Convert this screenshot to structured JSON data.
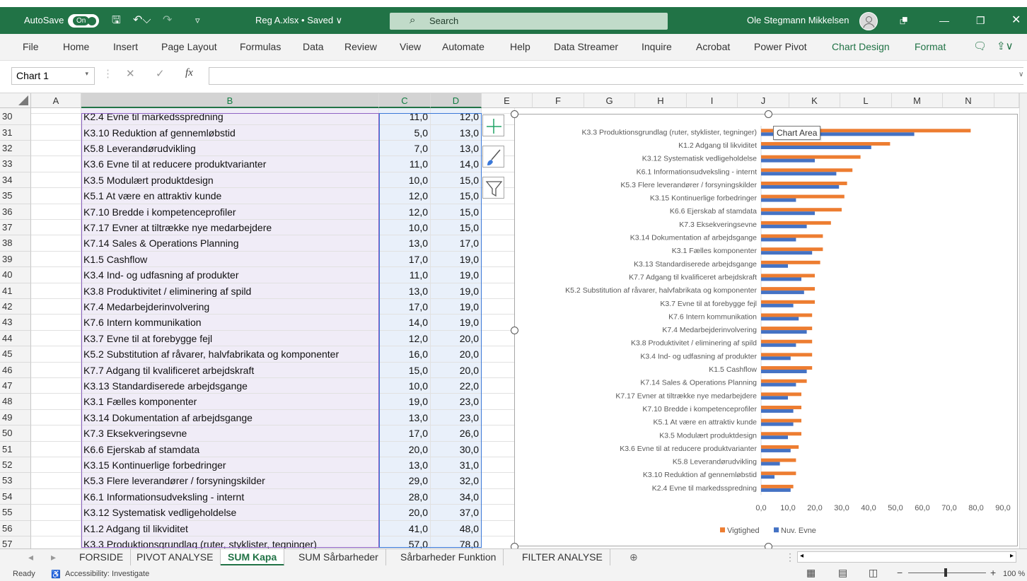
{
  "titlebar": {
    "autosave_label": "AutoSave",
    "autosave_state": "On",
    "doc_title": "Reg A.xlsx • Saved ∨",
    "search_placeholder": "Search",
    "user_name": "Ole Stegmann Mikkelsen"
  },
  "menu": [
    "File",
    "Home",
    "Insert",
    "Page Layout",
    "Formulas",
    "Data",
    "Review",
    "View",
    "Automate",
    "Help",
    "Data Streamer",
    "Inquire",
    "Acrobat",
    "Power Pivot",
    "Chart Design",
    "Format"
  ],
  "formula_bar": {
    "name_box": "Chart 1",
    "fx": "fx",
    "value": ""
  },
  "columns": [
    "A",
    "B",
    "C",
    "D",
    "E",
    "F",
    "G",
    "H",
    "I",
    "J",
    "K",
    "L",
    "M",
    "N"
  ],
  "rows": [
    {
      "n": "30",
      "b": "K2.4 Evne til markedsspredning",
      "c": "11,0",
      "d": "12,0"
    },
    {
      "n": "31",
      "b": "K3.10 Reduktion af gennemløbstid",
      "c": "5,0",
      "d": "13,0"
    },
    {
      "n": "32",
      "b": "K5.8 Leverandørudvikling",
      "c": "7,0",
      "d": "13,0"
    },
    {
      "n": "33",
      "b": "K3.6 Evne til at reducere produktvarianter",
      "c": "11,0",
      "d": "14,0"
    },
    {
      "n": "34",
      "b": "K3.5 Modulært produktdesign",
      "c": "10,0",
      "d": "15,0"
    },
    {
      "n": "35",
      "b": "K5.1 At være en attraktiv kunde",
      "c": "12,0",
      "d": "15,0"
    },
    {
      "n": "36",
      "b": "K7.10 Bredde i kompetenceprofiler",
      "c": "12,0",
      "d": "15,0"
    },
    {
      "n": "37",
      "b": "K7.17 Evner at tiltrække nye medarbejdere",
      "c": "10,0",
      "d": "15,0"
    },
    {
      "n": "38",
      "b": "K7.14 Sales & Operations Planning",
      "c": "13,0",
      "d": "17,0"
    },
    {
      "n": "39",
      "b": "K1.5 Cashflow",
      "c": "17,0",
      "d": "19,0"
    },
    {
      "n": "40",
      "b": "K3.4 Ind- og udfasning af produkter",
      "c": "11,0",
      "d": "19,0"
    },
    {
      "n": "41",
      "b": "K3.8 Produktivitet / eliminering af spild",
      "c": "13,0",
      "d": "19,0"
    },
    {
      "n": "42",
      "b": "K7.4 Medarbejderinvolvering",
      "c": "17,0",
      "d": "19,0"
    },
    {
      "n": "43",
      "b": "K7.6 Intern kommunikation",
      "c": "14,0",
      "d": "19,0"
    },
    {
      "n": "44",
      "b": "K3.7 Evne til at forebygge fejl",
      "c": "12,0",
      "d": "20,0"
    },
    {
      "n": "45",
      "b": "K5.2 Substitution af råvarer, halvfabrikata og komponenter",
      "c": "16,0",
      "d": "20,0"
    },
    {
      "n": "46",
      "b": "K7.7 Adgang til kvalificeret arbejdskraft",
      "c": "15,0",
      "d": "20,0"
    },
    {
      "n": "47",
      "b": "K3.13 Standardiserede arbejdsgange",
      "c": "10,0",
      "d": "22,0"
    },
    {
      "n": "48",
      "b": "K3.1 Fælles komponenter",
      "c": "19,0",
      "d": "23,0"
    },
    {
      "n": "49",
      "b": "K3.14 Dokumentation af arbejdsgange",
      "c": "13,0",
      "d": "23,0"
    },
    {
      "n": "50",
      "b": "K7.3 Eksekveringsevne",
      "c": "17,0",
      "d": "26,0"
    },
    {
      "n": "51",
      "b": "K6.6 Ejerskab af stamdata",
      "c": "20,0",
      "d": "30,0"
    },
    {
      "n": "52",
      "b": "K3.15 Kontinuerlige forbedringer",
      "c": "13,0",
      "d": "31,0"
    },
    {
      "n": "53",
      "b": "K5.3 Flere leverandører / forsyningskilder",
      "c": "29,0",
      "d": "32,0"
    },
    {
      "n": "54",
      "b": "K6.1 Informationsudveksling - internt",
      "c": "28,0",
      "d": "34,0"
    },
    {
      "n": "55",
      "b": "K3.12 Systematisk vedligeholdelse",
      "c": "20,0",
      "d": "37,0"
    },
    {
      "n": "56",
      "b": "K1.2 Adgang til likviditet",
      "c": "41,0",
      "d": "48,0"
    },
    {
      "n": "57",
      "b": "K3.3 Produktionsgrundlag (ruter, styklister, tegninger)",
      "c": "57,0",
      "d": "78,0"
    }
  ],
  "chart_tooltip": "Chart Area",
  "chart_data": {
    "type": "bar",
    "orientation": "horizontal",
    "categories": [
      "K3.3 Produktionsgrundlag (ruter, styklister, tegninger)",
      "K1.2 Adgang til likviditet",
      "K3.12 Systematisk vedligeholdelse",
      "K6.1 Informationsudveksling - internt",
      "K5.3 Flere leverandører / forsyningskilder",
      "K3.15 Kontinuerlige forbedringer",
      "K6.6 Ejerskab af stamdata",
      "K7.3 Eksekveringsevne",
      "K3.14 Dokumentation af arbejdsgange",
      "K3.1 Fælles komponenter",
      "K3.13 Standardiserede arbejdsgange",
      "K7.7 Adgang til kvalificeret arbejdskraft",
      "K5.2 Substitution af råvarer, halvfabrikata og komponenter",
      "K3.7 Evne til at forebygge fejl",
      "K7.6 Intern kommunikation",
      "K7.4 Medarbejderinvolvering",
      "K3.8 Produktivitet / eliminering af spild",
      "K3.4 Ind- og udfasning af produkter",
      "K1.5 Cashflow",
      "K7.14 Sales & Operations Planning",
      "K7.17 Evner at tiltrække nye medarbejdere",
      "K7.10 Bredde i kompetenceprofiler",
      "K5.1 At være en attraktiv kunde",
      "K3.5 Modulært produktdesign",
      "K3.6 Evne til at reducere produktvarianter",
      "K5.8 Leverandørudvikling",
      "K3.10 Reduktion af gennemløbstid",
      "K2.4 Evne til markedsspredning"
    ],
    "series": [
      {
        "name": "Vigtighed",
        "color": "#ed7d31",
        "values": [
          78,
          48,
          37,
          34,
          32,
          31,
          30,
          26,
          23,
          23,
          22,
          20,
          20,
          20,
          19,
          19,
          19,
          19,
          19,
          17,
          15,
          15,
          15,
          15,
          14,
          13,
          13,
          12
        ]
      },
      {
        "name": "Nuv. Evne",
        "color": "#4472c4",
        "values": [
          57,
          41,
          20,
          28,
          29,
          13,
          20,
          17,
          13,
          19,
          10,
          15,
          16,
          12,
          14,
          17,
          13,
          11,
          17,
          13,
          10,
          12,
          12,
          10,
          11,
          7,
          5,
          11
        ]
      }
    ],
    "xlim": [
      0,
      90
    ],
    "xticks": [
      "0,0",
      "10,0",
      "20,0",
      "30,0",
      "40,0",
      "50,0",
      "60,0",
      "70,0",
      "80,0",
      "90,0"
    ],
    "legend": "bottom",
    "grid": false
  },
  "tabs": [
    "FORSIDE",
    "PIVOT ANALYSE",
    "SUM Kapa",
    "SUM Sårbarheder",
    "Sårbarheder Funktion",
    "FILTER ANALYSE"
  ],
  "active_tab": "SUM Kapa",
  "status": {
    "ready": "Ready",
    "accessibility": "Accessibility: Investigate",
    "zoom": "100 %"
  }
}
